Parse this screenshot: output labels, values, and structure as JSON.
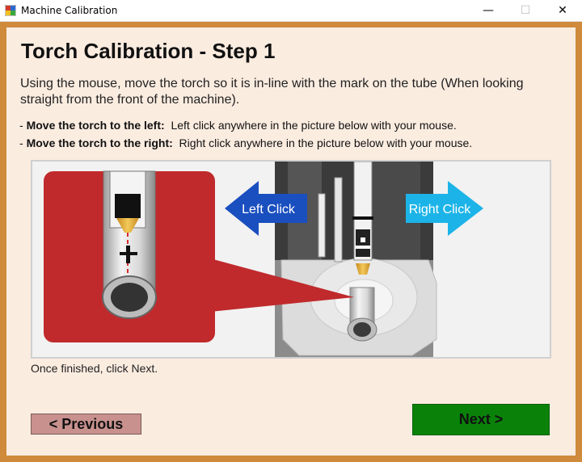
{
  "window": {
    "title": "Machine Calibration",
    "controls": {
      "minimize": "—",
      "maximize": "☐",
      "close": "✕"
    }
  },
  "page": {
    "heading": "Torch Calibration - Step 1",
    "intro": "Using the mouse, move the torch so it is in-line with the mark on the tube (When looking straight from the front of the machine).",
    "instructions": [
      {
        "prefix": "- ",
        "bold": "Move the torch to the left:",
        "text": "  Left click anywhere in the picture below with your mouse."
      },
      {
        "prefix": "- ",
        "bold": "Move the torch to the right:",
        "text": "  Right click anywhere in the picture below with your mouse."
      }
    ],
    "picture": {
      "left_label": "Left Click",
      "right_label": "Right Click"
    },
    "finished_text": "Once finished, click Next."
  },
  "buttons": {
    "previous": "< Previous",
    "next": "Next >"
  },
  "colors": {
    "frame": "#d08a3c",
    "client_bg": "#fbece0",
    "callout_red": "#c02a2c",
    "left_arrow": "#1a4fbf",
    "right_arrow": "#1cb4e8",
    "next_button": "#0a820a",
    "previous_button": "#c8918e"
  }
}
